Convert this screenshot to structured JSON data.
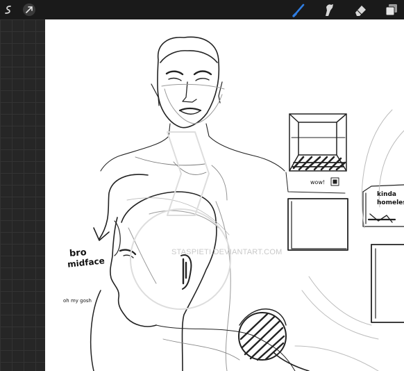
{
  "toolbar": {
    "left_tools": [
      {
        "name": "selection-icon"
      },
      {
        "name": "transform-icon"
      }
    ],
    "right_tools": [
      {
        "name": "brush-icon",
        "active": true,
        "color": "#2f7de1"
      },
      {
        "name": "smudge-icon"
      },
      {
        "name": "eraser-icon"
      },
      {
        "name": "layers-icon"
      }
    ]
  },
  "canvas": {
    "annotations": {
      "bro": "bro",
      "midface": "midface",
      "oh_my_gosh": "oh my gosh",
      "wow": "wow!",
      "kinda": "kinda",
      "homeless": "homeless"
    },
    "watermark": "STASPIETI.DEVIANTART.COM"
  }
}
